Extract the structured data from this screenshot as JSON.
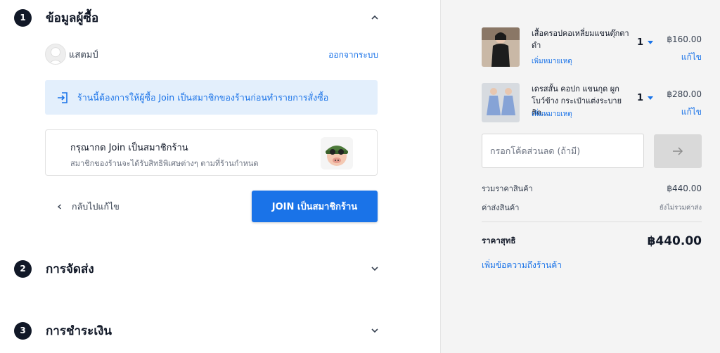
{
  "steps": [
    {
      "number": "1",
      "title": "ข้อมูลผู้ซื้อ"
    },
    {
      "number": "2",
      "title": "การจัดส่ง"
    },
    {
      "number": "3",
      "title": "การชำระเงิน"
    }
  ],
  "buyer": {
    "user_name": "แสตมป์",
    "logout_label": "ออกจากระบบ",
    "notice": "ร้านนี้ต้องการให้ผู้ซื้อ Join เป็นสมาชิกของร้านก่อนทำรายการสั่งซื้อ",
    "join_card": {
      "title": "กรุณากด Join เป็นสมาชิกร้าน",
      "subtitle": "สมาชิกของร้านจะได้รับสิทธิพิเศษต่างๆ ตามที่ร้านกำหนด"
    },
    "back_label": "กลับไปแก้ไข",
    "join_button": "JOIN เป็นสมาชิกร้าน"
  },
  "cart": {
    "items": [
      {
        "name": "เสื้อครอปคอเหลี่ยมแขนตุ๊กตา ดำ",
        "note_label": "เพิ่มหมายเหตุ",
        "qty": "1",
        "price": "฿160.00",
        "edit_label": "แก้ไข"
      },
      {
        "name": "เดรสสั้น คอปก แขนกุด ผูกโบว์ข้าง กระเป๋าแต่งระบาย ติด...",
        "note_label": "เพิ่มหมายเหตุ",
        "qty": "1",
        "price": "฿280.00",
        "edit_label": "แก้ไข"
      }
    ],
    "coupon_placeholder": "กรอกโค้ดส่วนลด (ถ้ามี)",
    "subtotal_label": "รวมราคาสินค้า",
    "subtotal_value": "฿440.00",
    "shipping_label": "ค่าส่งสินค้า",
    "shipping_value": "ยังไม่รวมค่าส่ง",
    "total_label": "ราคาสุทธิ",
    "total_value": "฿440.00",
    "add_message_label": "เพิ่มข้อความถึงร้านค้า"
  },
  "colors": {
    "accent": "#1a73e8",
    "step_badge": "#111827",
    "notice_bg": "#e3effc",
    "sidebar_bg": "#f4f4f4"
  }
}
